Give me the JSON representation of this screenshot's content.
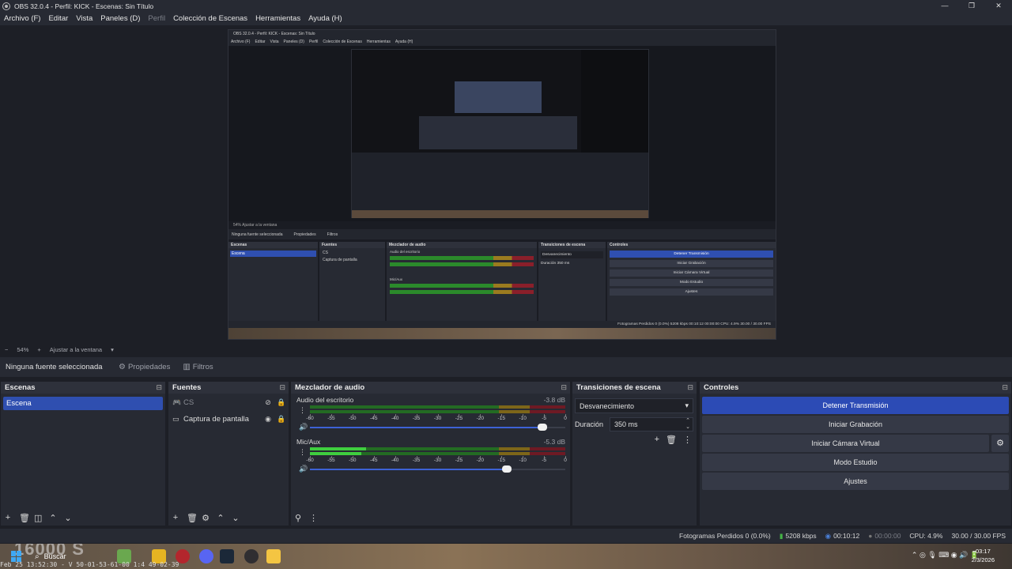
{
  "window": {
    "title": "OBS 32.0.4 - Perfil: KICK - Escenas: Sin Título",
    "controls": [
      "—",
      "❐",
      "✕"
    ]
  },
  "menu": {
    "items": [
      "Archivo (F)",
      "Editar",
      "Vista",
      "Paneles (D)",
      "Perfil",
      "Colección de Escenas",
      "Herramientas",
      "Ayuda (H)"
    ]
  },
  "nested_preview": {
    "title": "OBS 32.0.4 - Perfil: KICK - Escenas: Sin Título",
    "menu": [
      "Archivo (F)",
      "Editar",
      "Vista",
      "Paneles (D)",
      "Perfil",
      "Colección de Escenas",
      "Herramientas",
      "Ayuda (H)"
    ],
    "zoom": "54%   Ajustar a la ventana",
    "source_bar": [
      "Ninguna fuente seleccionada",
      "Propiedades",
      "Filtros"
    ],
    "docks": {
      "scenes": "Escenas",
      "scene_item": "Escena",
      "sources": "Fuentes",
      "source_items": [
        "CS",
        "Captura de pantalla"
      ],
      "mixer": "Mezclador de audio",
      "mixer_ch1": "Audio del escritorio",
      "mixer_ch2": "Mic/Aux",
      "transitions": "Transiciones de escena",
      "transition_value": "Desvanecimiento",
      "duration_label": "Duración",
      "duration_value": "350 ms",
      "controls": "Controles",
      "buttons": [
        "Detener Transmisión",
        "Iniciar Grabación",
        "Iniciar Cámara Virtual",
        "Modo Estudio",
        "Ajustes"
      ]
    },
    "status": "Fotogramas Perdidos 0 (0.0%)   5208 kbps   00:10:12   00:00:00   CPU: 4.9%   30.00 / 30.00 FPS"
  },
  "zoom_bar": {
    "minus": "−",
    "zoom": "54%",
    "plus": "+",
    "fit": "Ajustar a la ventana",
    "arrow": "▾"
  },
  "source_toolbar": {
    "no_source": "Ninguna fuente seleccionada",
    "properties": "Propiedades",
    "filters": "Filtros"
  },
  "scenes": {
    "title": "Escenas",
    "items": [
      "Escena"
    ]
  },
  "sources": {
    "title": "Fuentes",
    "items": [
      {
        "icon": "gamepad-icon",
        "label": "CS",
        "visible": false
      },
      {
        "icon": "monitor-icon",
        "label": "Captura de pantalla",
        "visible": true
      }
    ]
  },
  "mixer": {
    "title": "Mezclador de audio",
    "channels": [
      {
        "name": "Audio del escritorio",
        "db": "-3.8 dB",
        "level1": 0.0,
        "level2": 0.0,
        "volume": 0.91
      },
      {
        "name": "Mic/Aux",
        "db": "-5.3 dB",
        "level1": 0.22,
        "level2": 0.2,
        "volume": 0.77
      }
    ],
    "ticks": [
      "-60",
      "-55",
      "-50",
      "-45",
      "-40",
      "-35",
      "-30",
      "-25",
      "-20",
      "-15",
      "-10",
      "-5",
      "0"
    ]
  },
  "transitions": {
    "title": "Transiciones de escena",
    "selected": "Desvanecimiento",
    "duration_label": "Duración",
    "duration_value": "350 ms"
  },
  "controls": {
    "title": "Controles",
    "stop_stream": "Detener Transmisión",
    "start_recording": "Iniciar Grabación",
    "start_virtual_cam": "Iniciar Cámara Virtual",
    "studio_mode": "Modo Estudio",
    "settings": "Ajustes"
  },
  "status": {
    "dropped_frames": "Fotogramas Perdidos 0 (0.0%)",
    "bitrate": "5208 kbps",
    "stream_time": "00:10:12",
    "record_time": "00:00:00",
    "cpu": "CPU: 4.9%",
    "fps": "30.00 / 30.00 FPS"
  },
  "taskbar": {
    "search": "Buscar",
    "big_text": "16000  S",
    "ticker": "Feb 25  13:52:30  -  V 50-01-53-61-00  1:4  49-02-39",
    "time": "03:17",
    "date": "2/3/2026"
  },
  "colors": {
    "accent": "#2c4bb5",
    "panel": "#272a33",
    "background": "#1d1f26"
  }
}
